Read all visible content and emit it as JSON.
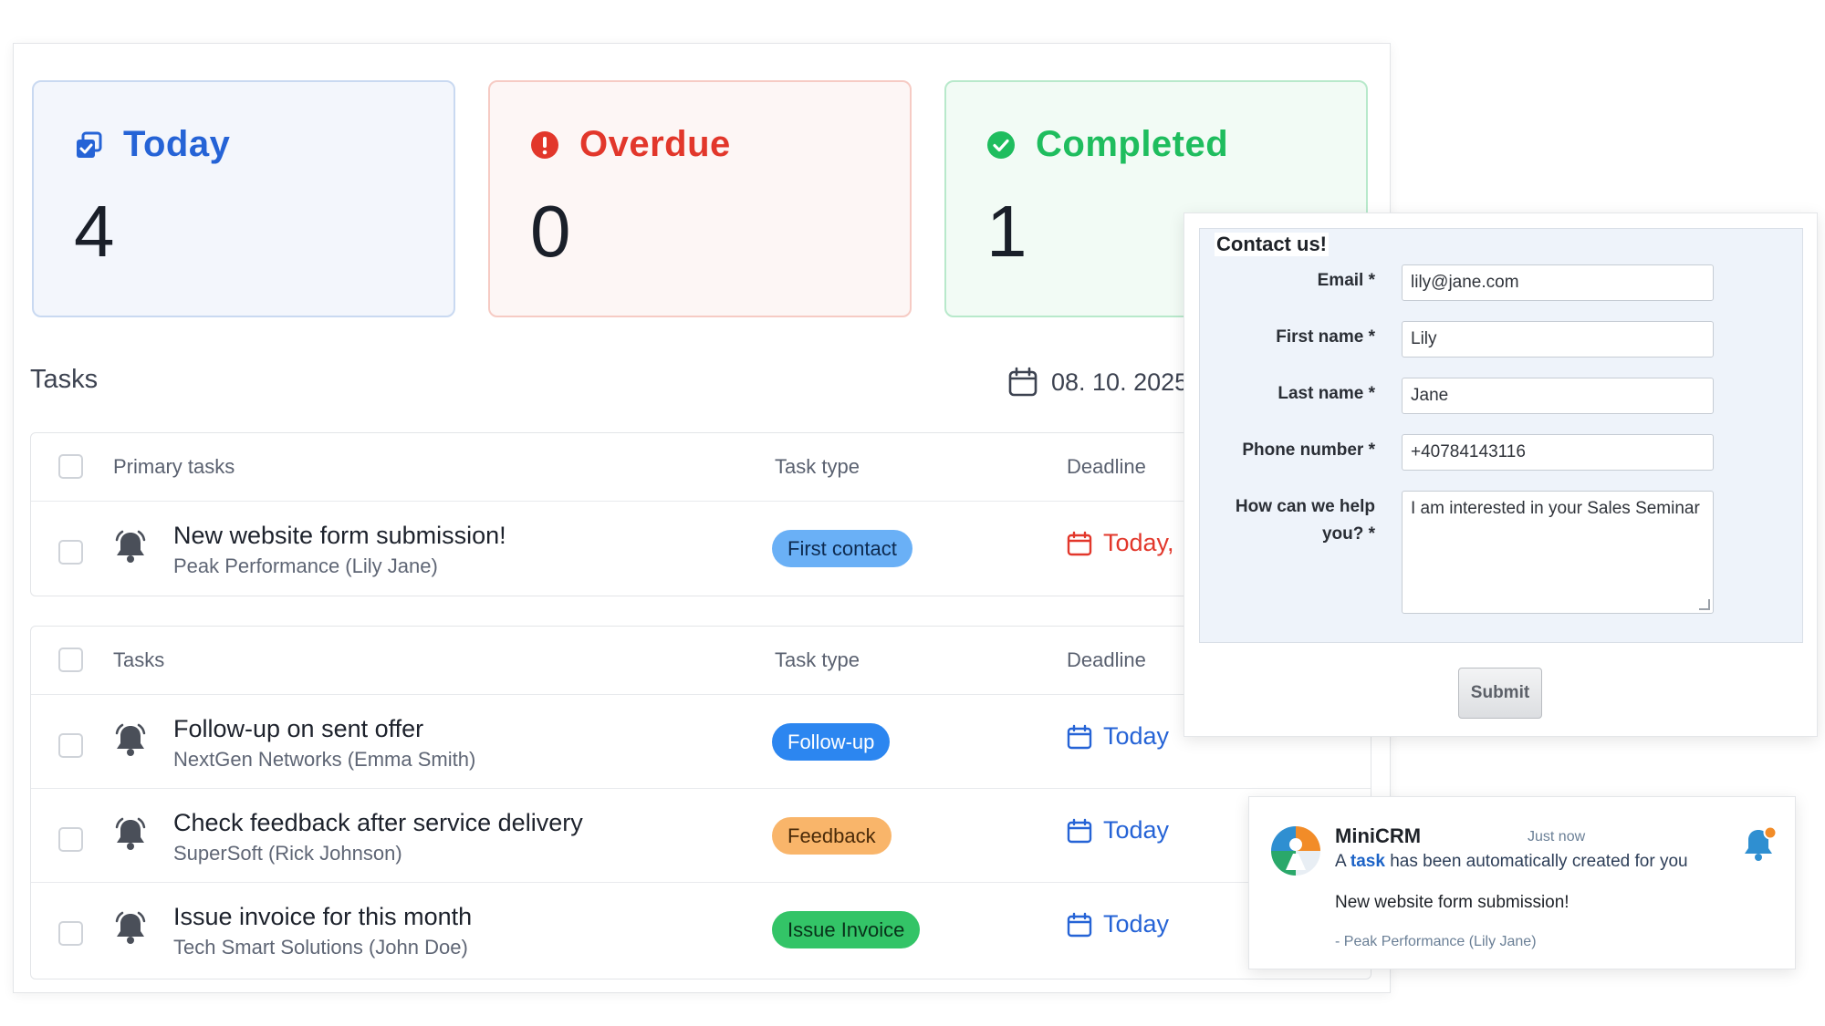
{
  "colors": {
    "today": "#2563d6",
    "overdue": "#e2372b",
    "completed": "#1fbd5e",
    "badge_first_contact": "#6ab0f6",
    "badge_follow_up": "#2c86f0",
    "badge_feedback": "#f9b56a",
    "badge_issue_invoice": "#33c467"
  },
  "stats": {
    "today": {
      "label": "Today",
      "value": "4",
      "icon": "checkbox-stack-icon"
    },
    "overdue": {
      "label": "Overdue",
      "value": "0",
      "icon": "alert-circle-icon"
    },
    "completed": {
      "label": "Completed",
      "value": "1",
      "icon": "check-circle-icon"
    }
  },
  "tasks_heading": "Tasks",
  "date_filter": "08. 10. 2025",
  "primary_table": {
    "columns": [
      "Primary tasks",
      "Task type",
      "Deadline"
    ],
    "rows": [
      {
        "title": "New website form submission!",
        "subtitle": "Peak Performance (Lily Jane)",
        "type": "First contact",
        "deadline": "Today,"
      }
    ]
  },
  "tasks_table": {
    "columns": [
      "Tasks",
      "Task type",
      "Deadline"
    ],
    "rows": [
      {
        "title": "Follow-up on sent offer",
        "subtitle": "NextGen Networks (Emma Smith)",
        "type": "Follow-up",
        "deadline": "Today"
      },
      {
        "title": "Check feedback after service delivery",
        "subtitle": "SuperSoft (Rick Johnson)",
        "type": "Feedback",
        "deadline": "Today"
      },
      {
        "title": "Issue invoice for this month",
        "subtitle": "Tech Smart Solutions (John Doe)",
        "type": "Issue Invoice",
        "deadline": "Today"
      }
    ]
  },
  "contact_form": {
    "title": "Contact us!",
    "email_label": "Email *",
    "email_value": "lily@jane.com",
    "first_name_label": "First name *",
    "first_name_value": "Lily",
    "last_name_label": "Last name *",
    "last_name_value": "Jane",
    "phone_label": "Phone number *",
    "phone_value": "+40784143116",
    "help_label_line1": "How can we help",
    "help_label_line2": "you? *",
    "help_value": "I am interested in your Sales Seminar",
    "submit_label": "Submit"
  },
  "notification": {
    "app": "MiniCRM",
    "time": "Just now",
    "msg_prefix": "A",
    "msg_link": "task",
    "msg_suffix": "has been automatically created for you",
    "body": "New website form submission!",
    "footer": "- Peak Performance (Lily Jane)"
  }
}
